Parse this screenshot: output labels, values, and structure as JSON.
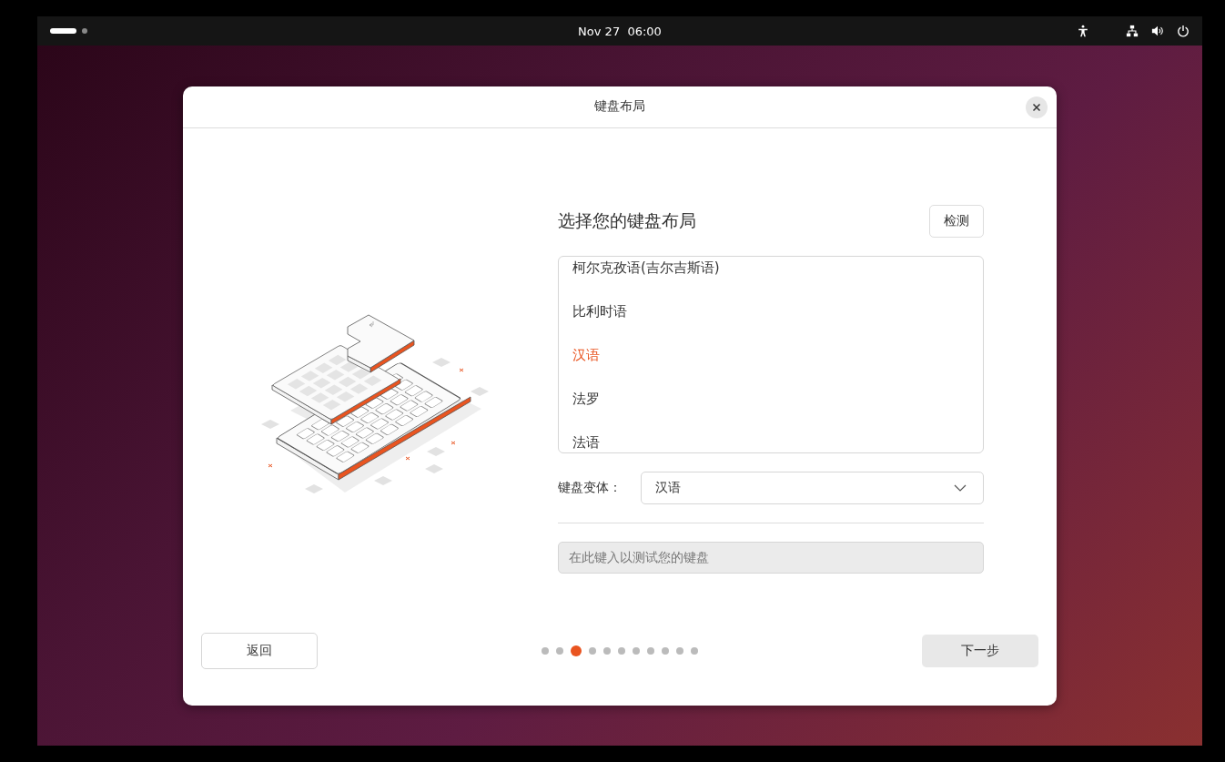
{
  "top_bar": {
    "workspaces": [
      {
        "selected": true
      },
      {
        "selected": false
      }
    ],
    "clock": "Nov 27  06:00"
  },
  "dialog": {
    "title": "键盘布局",
    "heading": "选择您的键盘布局",
    "detect_button": "检测",
    "layouts": [
      {
        "label": "柯尔克孜语(吉尔吉斯语)",
        "selected": false
      },
      {
        "label": "比利时语",
        "selected": false
      },
      {
        "label": "汉语",
        "selected": true
      },
      {
        "label": "法罗",
        "selected": false
      },
      {
        "label": "法语",
        "selected": false
      }
    ],
    "variant": {
      "label": "键盘变体：",
      "value": "汉语"
    },
    "test_field": {
      "placeholder": "在此键入以测试您的键盘"
    },
    "back_button": "返回",
    "next_button": "下一步",
    "steps": [
      {
        "selected": false
      },
      {
        "selected": false
      },
      {
        "selected": true
      },
      {
        "selected": false
      },
      {
        "selected": false
      },
      {
        "selected": false
      },
      {
        "selected": false
      },
      {
        "selected": false
      },
      {
        "selected": false
      },
      {
        "selected": false
      },
      {
        "selected": false
      }
    ]
  }
}
